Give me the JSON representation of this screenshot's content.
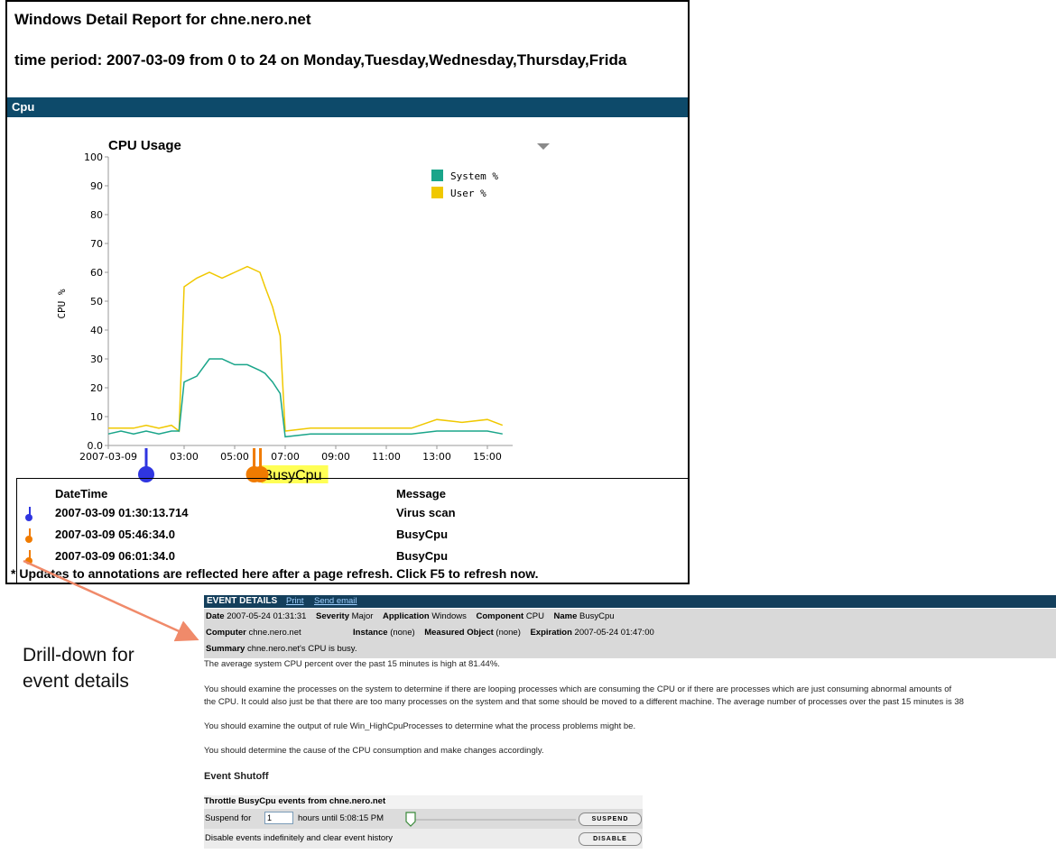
{
  "report": {
    "title": "Windows Detail Report for chne.nero.net",
    "period": "time period: 2007-03-09 from 0 to 24 on Monday,Tuesday,Wednesday,Thursday,Frida",
    "section": "Cpu",
    "chart_menu_icon": "triangle-down-icon"
  },
  "chart_data": {
    "type": "line",
    "title": "CPU Usage",
    "ylabel": "CPU %",
    "xlabel": "",
    "ylim": [
      0,
      100
    ],
    "y_ticks": [
      "0.0",
      "10",
      "20",
      "30",
      "40",
      "50",
      "60",
      "70",
      "80",
      "90",
      "100"
    ],
    "x_ticks": [
      "2007-03-09",
      "03:00",
      "05:00",
      "07:00",
      "09:00",
      "11:00",
      "13:00",
      "15:00"
    ],
    "x_hours": [
      0,
      3,
      5,
      7,
      9,
      11,
      13,
      15
    ],
    "legend_position": "top-right",
    "series": [
      {
        "name": "System %",
        "color": "#1aa58a",
        "x": [
          0,
          0.5,
          1,
          1.5,
          2,
          2.5,
          2.8,
          3,
          3.5,
          4,
          4.5,
          5,
          5.5,
          6,
          6.2,
          6.5,
          6.8,
          7,
          8,
          9,
          10,
          11,
          12,
          13,
          14,
          15,
          15.6
        ],
        "y": [
          4,
          5,
          4,
          5,
          4,
          5,
          5,
          22,
          24,
          30,
          30,
          28,
          28,
          26,
          25,
          22,
          18,
          3,
          4,
          4,
          4,
          4,
          4,
          5,
          5,
          5,
          4
        ]
      },
      {
        "name": "User %",
        "color": "#f0c800",
        "x": [
          0,
          0.5,
          1,
          1.5,
          2,
          2.5,
          2.8,
          3,
          3.5,
          4,
          4.5,
          5,
          5.5,
          6,
          6.2,
          6.5,
          6.8,
          7,
          8,
          9,
          10,
          11,
          12,
          13,
          14,
          15,
          15.6
        ],
        "y": [
          6,
          6,
          6,
          7,
          6,
          7,
          5,
          55,
          58,
          60,
          58,
          60,
          62,
          60,
          55,
          48,
          38,
          5,
          6,
          6,
          6,
          6,
          6,
          9,
          8,
          9,
          7
        ]
      }
    ],
    "annotations": [
      {
        "hour": 1.5,
        "color": "#2f35e0",
        "label": ""
      },
      {
        "hour": 5.77,
        "color": "#f07b00",
        "label": "BusyCpu"
      },
      {
        "hour": 6.02,
        "color": "#f07b00",
        "label": ""
      }
    ]
  },
  "annotations_table": {
    "headers": [
      "DateTime",
      "Message"
    ],
    "rows": [
      {
        "datetime": "2007-03-09 01:30:13.714",
        "message": "Virus scan",
        "pin_color": "#2f35e0"
      },
      {
        "datetime": "2007-03-09 05:46:34.0",
        "message": "BusyCpu",
        "pin_color": "#f07b00"
      },
      {
        "datetime": "2007-03-09 06:01:34.0",
        "message": "BusyCpu",
        "pin_color": "#f07b00"
      }
    ],
    "note": "* Updates to annotations are reflected here after a page refresh. Click F5 to refresh now."
  },
  "callout": {
    "text": "Drill-down for event details",
    "arrow_color": "#f08a6a"
  },
  "event": {
    "header_title": "EVENT DETAILS",
    "print_link": "Print",
    "email_link": "Send email",
    "date_label": "Date",
    "date_value": "2007-05-24 01:31:31",
    "severity_label": "Severity",
    "severity_value": "Major",
    "application_label": "Application",
    "application_value": "Windows",
    "component_label": "Component",
    "component_value": "CPU",
    "name_label": "Name",
    "name_value": "BusyCpu",
    "computer_label": "Computer",
    "computer_value": "chne.nero.net",
    "instance_label": "Instance",
    "instance_value": "(none)",
    "measured_label": "Measured Object",
    "measured_value": "(none)",
    "expiration_label": "Expiration",
    "expiration_value": "2007-05-24 01:47:00",
    "summary_label": "Summary",
    "summary_value": "chne.nero.net's CPU is busy.",
    "p1": "The average system CPU percent over the past 15 minutes is high at 81.44%.",
    "p2a": "You should examine the processes on the system to determine if there are looping processes which are consuming the CPU or if there are processes which are just consuming abnormal amounts of",
    "p2b": "the CPU. It could also just be that there are too many processes on the system and that some should be moved to a different machine. The average number of processes over the past 15 minutes is 38",
    "p3": "You should examine the output of rule Win_HighCpuProcesses to determine what the process problems might be.",
    "p4": "You should determine the cause of the CPU consumption and make changes accordingly.",
    "shutoff_title": "Event Shutoff",
    "throttle_title": "Throttle BusyCpu events from chne.nero.net",
    "suspend_for": "Suspend for",
    "suspend_value": "1",
    "hours_until": "hours  until 5:08:15 PM",
    "suspend_button": "SUSPEND",
    "disable_text": "Disable events indefinitely and clear event history",
    "disable_button": "DISABLE"
  }
}
